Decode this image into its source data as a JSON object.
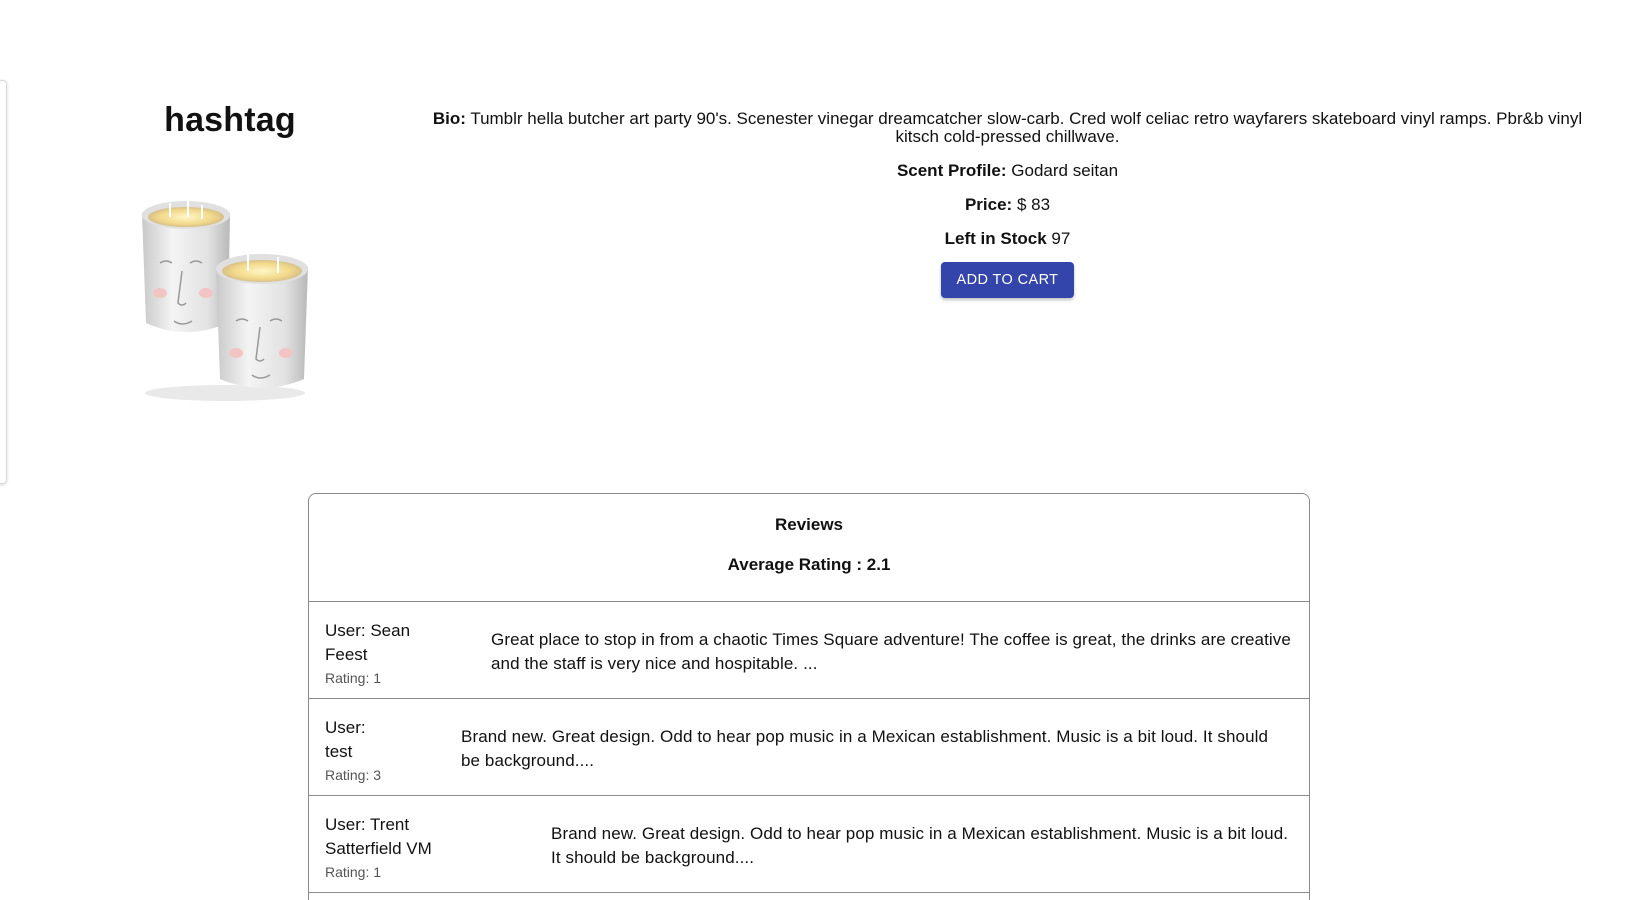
{
  "product": {
    "title": "hashtag",
    "image_alt": "Two white face candles",
    "bio_label": "Bio:",
    "bio": "Tumblr hella butcher art party 90's. Scenester vinegar dreamcatcher slow-carb. Cred wolf celiac retro wayfarers skateboard vinyl ramps. Pbr&b vinyl kitsch cold-pressed chillwave.",
    "scent_label": "Scent Profile:",
    "scent": "Godard seitan",
    "price_label": "Price:",
    "price": "$ 83",
    "stock_label": "Left in Stock",
    "stock": "97",
    "add_to_cart": "ADD TO CART"
  },
  "reviews": {
    "title": "Reviews",
    "average_rating": "Average Rating : 2.1",
    "items": [
      {
        "user": "User: Sean Feest",
        "user_line1": "User: Sean",
        "user_line2": "Feest",
        "rating": "Rating: 1",
        "text": "Great place to stop in from a chaotic Times Square adventure! The coffee is great, the drinks are creative and the staff is very nice and hospitable. ..."
      },
      {
        "user": "User: test",
        "user_line1": "User:",
        "user_line2": "test",
        "rating": "Rating: 3",
        "text": "Brand new. Great design. Odd to hear pop music in a Mexican establishment. Music is a bit loud. It should be background...."
      },
      {
        "user": "User: Trent Satterfield VM",
        "user_line1": "User: Trent",
        "user_line2": "Satterfield VM",
        "rating": "Rating: 1",
        "text": "Brand new. Great design. Odd to hear pop music in a Mexican establishment. Music is a bit loud. It should be background...."
      }
    ]
  },
  "colors": {
    "button": "#3344aa",
    "border": "#8a8a8a"
  }
}
